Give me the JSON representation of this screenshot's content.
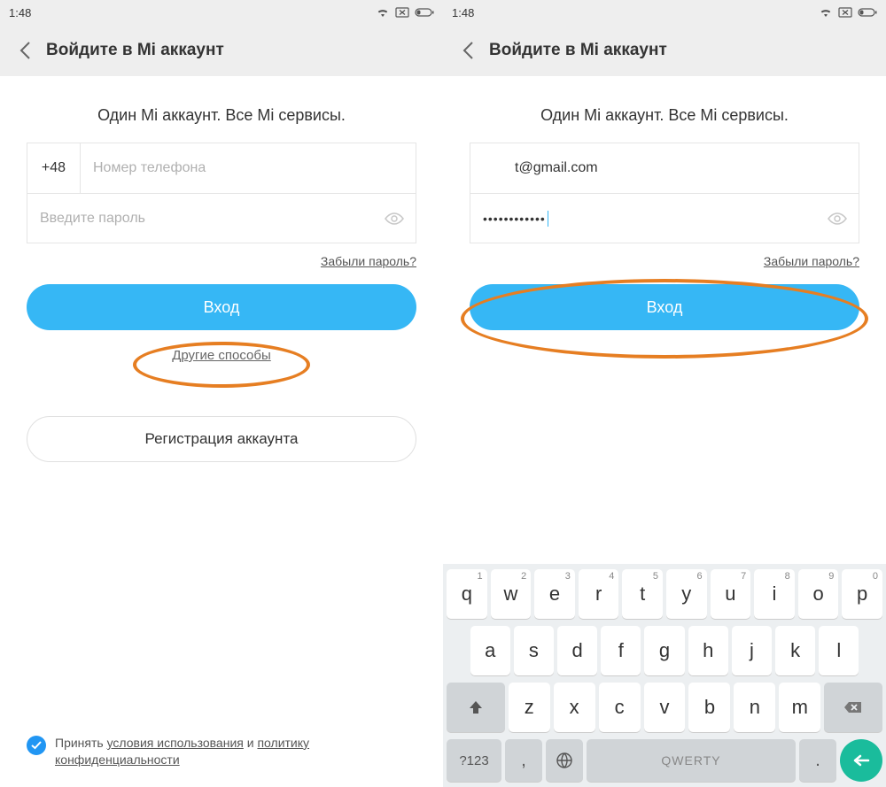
{
  "status": {
    "time": "1:48"
  },
  "nav": {
    "title": "Войдите в Mi аккаунт"
  },
  "tagline": "Один Mi аккаунт. Все Mi сервисы.",
  "left": {
    "cc": "+48",
    "phone_ph": "Номер телефона",
    "pw_ph": "Введите пароль",
    "forgot": "Забыли пароль?",
    "login": "Вход",
    "other": "Другие способы",
    "register": "Регистрация аккаунта"
  },
  "right": {
    "email": "t@gmail.com",
    "pw": "••••••••••••",
    "forgot": "Забыли пароль?",
    "login": "Вход"
  },
  "footer": {
    "pre": "Принять ",
    "tos": "условия использования",
    "mid": " и ",
    "pp": "политику конфиденциальности"
  },
  "kb": {
    "r1": [
      [
        "q",
        "1"
      ],
      [
        "w",
        "2"
      ],
      [
        "e",
        "3"
      ],
      [
        "r",
        "4"
      ],
      [
        "t",
        "5"
      ],
      [
        "y",
        "6"
      ],
      [
        "u",
        "7"
      ],
      [
        "i",
        "8"
      ],
      [
        "o",
        "9"
      ],
      [
        "p",
        "0"
      ]
    ],
    "r2": [
      "a",
      "s",
      "d",
      "f",
      "g",
      "h",
      "j",
      "k",
      "l"
    ],
    "r3": [
      "z",
      "x",
      "c",
      "v",
      "b",
      "n",
      "m"
    ],
    "sym": "?123",
    "comma": ",",
    "space": "QWERTY",
    "dot": "."
  }
}
